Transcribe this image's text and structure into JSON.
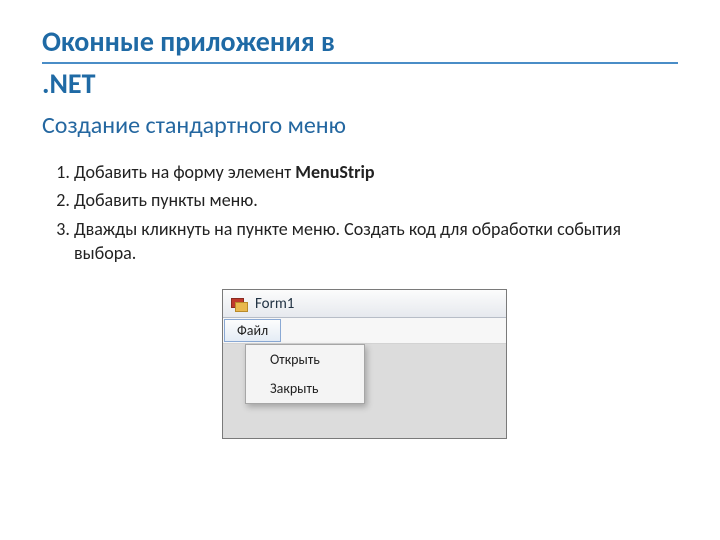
{
  "title_line1": "Оконные приложения в",
  "title_line2": ".NET",
  "subtitle": "Создание стандартного меню",
  "steps": [
    {
      "pre": "Добавить на форму элемент ",
      "bold": "MenuStrip",
      "post": ""
    },
    {
      "pre": "Добавить пункты меню.",
      "bold": "",
      "post": ""
    },
    {
      "pre": "Дважды кликнуть на пункте меню. Создать код для обработки события выбора.",
      "bold": "",
      "post": ""
    }
  ],
  "mock": {
    "window_title": "Form1",
    "menu_top": "Файл",
    "dropdown": [
      "Открыть",
      "Закрыть"
    ]
  }
}
